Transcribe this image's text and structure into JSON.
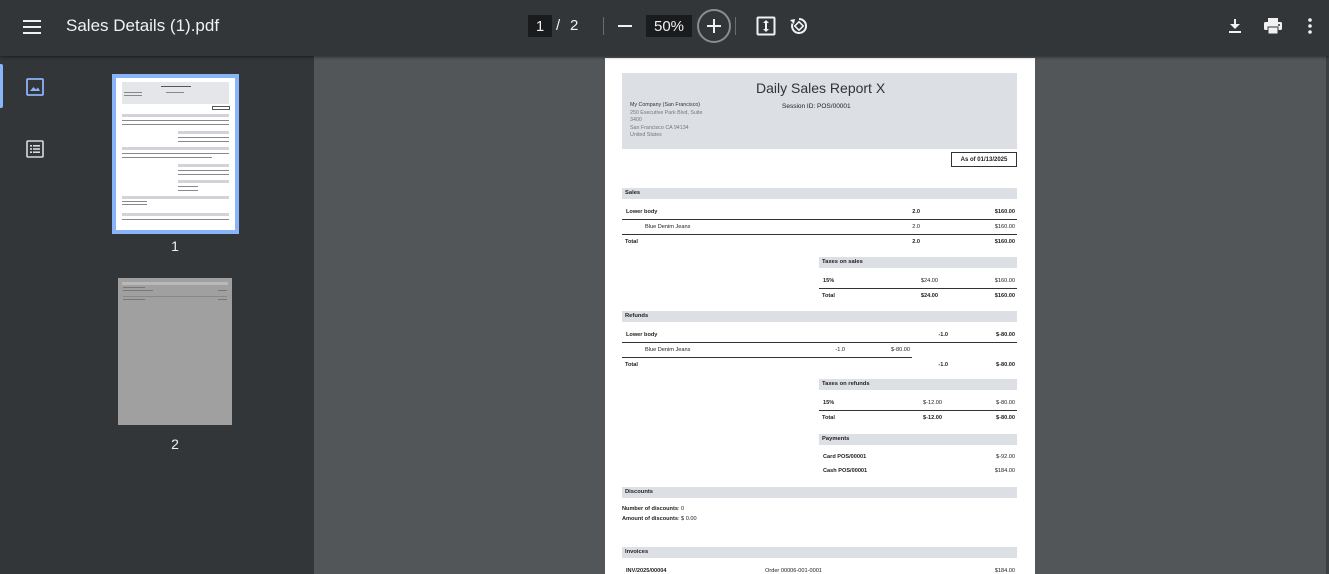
{
  "toolbar": {
    "title": "Sales Details (1).pdf",
    "current_page": "1",
    "page_separator": "/",
    "total_pages": "2",
    "zoom": "50%"
  },
  "sidebar": {
    "thumbnails": [
      {
        "label": "1",
        "selected": true
      },
      {
        "label": "2",
        "selected": false
      }
    ]
  },
  "document": {
    "title": "Daily Sales Report X",
    "session": "Session ID: POS/00001",
    "company_name": "My Company (San Francisco)",
    "address_line1": "250 Executive Park Blvd, Suite",
    "address_line2": "3400",
    "address_line3": "San Francisco CA 94134",
    "address_line4": "United States",
    "as_of": "As of 01/13/2025",
    "sales": {
      "heading": "Sales",
      "category": "Lower body",
      "category_qty": "2.0",
      "category_amount": "$160.00",
      "product": "Blue Denim Jeans",
      "product_qty": "2.0",
      "product_amount": "$160.00",
      "total_label": "Total",
      "total_qty": "2.0",
      "total_amount": "$160.00"
    },
    "taxes_on_sales": {
      "heading": "Taxes on sales",
      "rate": "15%",
      "tax": "$24.00",
      "base": "$160.00",
      "total_label": "Total",
      "total_tax": "$24.00",
      "total_base": "$160.00"
    },
    "refunds": {
      "heading": "Refunds",
      "category": "Lower body",
      "category_qty": "-1.0",
      "category_amount": "$-80.00",
      "product": "Blue Denim Jeans",
      "product_qty": "-1.0",
      "product_amount": "$-80.00",
      "total_label": "Total",
      "total_qty": "-1.0",
      "total_amount": "$-80.00"
    },
    "taxes_on_refunds": {
      "heading": "Taxes on refunds",
      "rate": "15%",
      "tax": "$-12.00",
      "base": "$-80.00",
      "total_label": "Total",
      "total_tax": "$-12.00",
      "total_base": "$-80.00"
    },
    "payments": {
      "heading": "Payments",
      "card_label": "Card POS/00001",
      "card_amount": "$-92.00",
      "cash_label": "Cash POS/00001",
      "cash_amount": "$184.00"
    },
    "discounts": {
      "heading": "Discounts",
      "count_label": "Number of discounts",
      "count_value": ": 0",
      "amount_label": "Amount of discounts",
      "amount_value": ": $ 0.00"
    },
    "invoices": {
      "heading": "Invoices",
      "invoice": "INV/2025/00004",
      "order": "Order 00006-001-0001",
      "amount": "$184.00"
    }
  }
}
